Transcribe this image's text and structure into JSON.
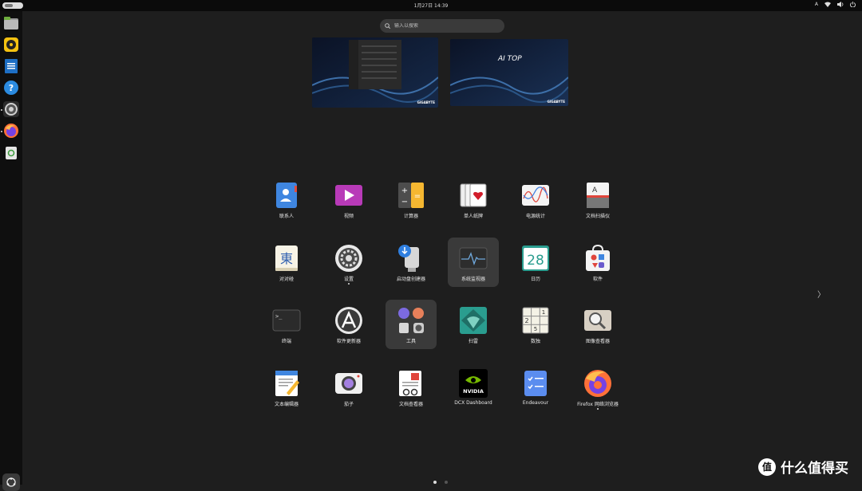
{
  "topbar": {
    "clock": "1月27日 14:39",
    "input_indicator": "A",
    "tray_icons": [
      "network-icon",
      "volume-icon",
      "power-icon"
    ]
  },
  "dock": {
    "items": [
      {
        "name": "files",
        "icon": "file-manager-icon"
      },
      {
        "name": "rhythmbox",
        "icon": "music-player-icon"
      },
      {
        "name": "libreoffice-writer",
        "icon": "writer-icon"
      },
      {
        "name": "help",
        "icon": "help-icon"
      },
      {
        "name": "settings",
        "icon": "settings-icon"
      },
      {
        "name": "firefox",
        "icon": "firefox-icon"
      },
      {
        "name": "trash",
        "icon": "trash-icon"
      }
    ]
  },
  "search": {
    "placeholder": "输入以搜索"
  },
  "workspaces": [
    {
      "brand": "GIGABYTE"
    },
    {
      "brand": "GIGABYTE",
      "logo": "AI TOP"
    }
  ],
  "apps": [
    [
      {
        "label": "联系人",
        "icon": "contacts-icon"
      },
      {
        "label": "视频",
        "icon": "videos-icon"
      },
      {
        "label": "计算器",
        "icon": "calculator-icon"
      },
      {
        "label": "单人纸牌",
        "icon": "solitaire-icon"
      },
      {
        "label": "电源统计",
        "icon": "power-statistics-icon"
      },
      {
        "label": "文档扫描仪",
        "icon": "document-scanner-icon"
      }
    ],
    [
      {
        "label": "对对碰",
        "icon": "mahjongg-icon",
        "glyph": "東"
      },
      {
        "label": "设置",
        "icon": "settings-icon",
        "running": true
      },
      {
        "label": "启动盘创建器",
        "icon": "startup-disk-creator-icon"
      },
      {
        "label": "系统监视器",
        "icon": "system-monitor-icon",
        "highlighted": true
      },
      {
        "label": "日历",
        "icon": "calendar-icon",
        "glyph": "28"
      },
      {
        "label": "软件",
        "icon": "software-icon"
      }
    ],
    [
      {
        "label": "终端",
        "icon": "terminal-icon",
        "glyph": ">_"
      },
      {
        "label": "软件更新器",
        "icon": "software-updater-icon"
      },
      {
        "label": "工具",
        "icon": "utilities-folder-icon",
        "highlighted": true
      },
      {
        "label": "扫雷",
        "icon": "mines-icon"
      },
      {
        "label": "数独",
        "icon": "sudoku-icon"
      },
      {
        "label": "图像查看器",
        "icon": "image-viewer-icon"
      }
    ],
    [
      {
        "label": "文本编辑器",
        "icon": "text-editor-icon"
      },
      {
        "label": "茄子",
        "icon": "cheese-icon"
      },
      {
        "label": "文档查看器",
        "icon": "document-viewer-icon"
      },
      {
        "label": "DCX Dashboard",
        "icon": "nvidia-icon",
        "glyph": "NVIDIA"
      },
      {
        "label": "Endeavour",
        "icon": "endeavour-icon"
      },
      {
        "label": "Firefox 网络浏览器",
        "icon": "firefox-icon",
        "running": true
      }
    ]
  ],
  "pager": {
    "pages": 2,
    "current": 1
  },
  "watermark": {
    "text": "什么值得买",
    "glyph": "值"
  },
  "colors": {
    "background": "#1e1e1e",
    "dock": "#0f0f0f",
    "topbar": "#0b0b0b",
    "highlight": "#3a3a3a"
  }
}
